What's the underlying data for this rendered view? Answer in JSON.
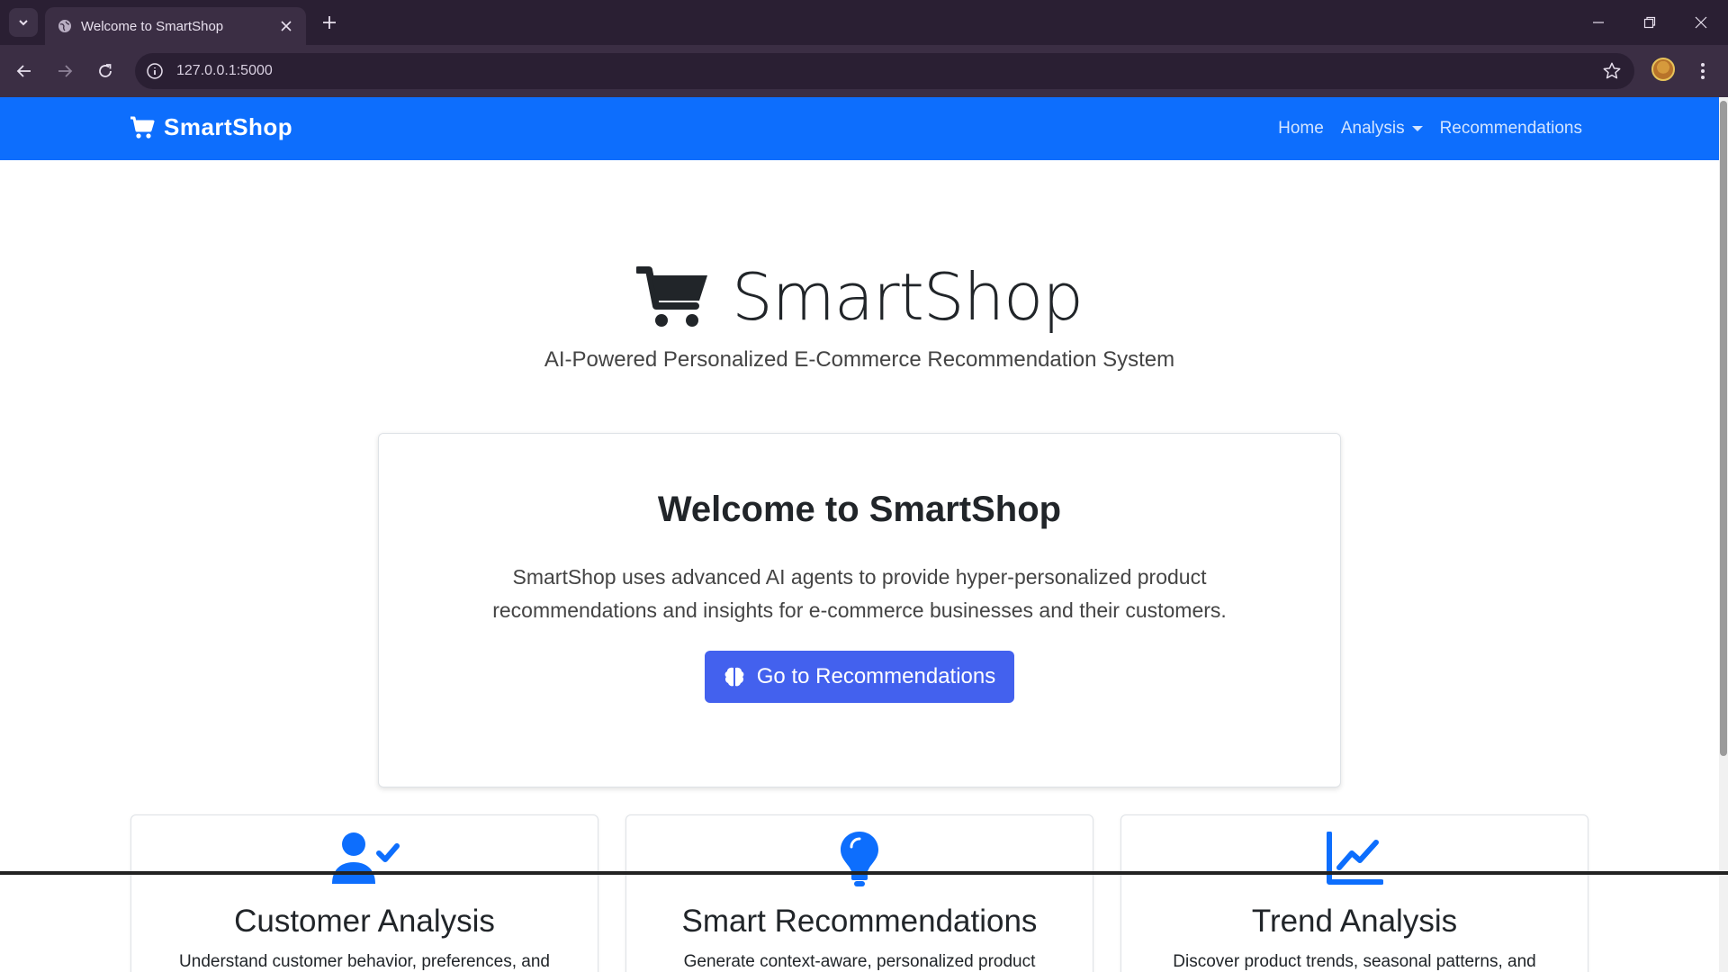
{
  "browser": {
    "tab_title": "Welcome to SmartShop",
    "url": "127.0.0.1:5000"
  },
  "navbar": {
    "brand": "SmartShop",
    "links": {
      "home": "Home",
      "analysis": "Analysis",
      "recommendations": "Recommendations"
    }
  },
  "hero": {
    "title": "SmartShop",
    "subtitle": "AI-Powered Personalized E-Commerce Recommendation System"
  },
  "welcome": {
    "title": "Welcome to SmartShop",
    "text": "SmartShop uses advanced AI agents to provide hyper-personalized product recommendations and insights for e-commerce businesses and their customers.",
    "button_label": "Go to Recommendations"
  },
  "features": [
    {
      "title": "Customer Analysis",
      "text": "Understand customer behavior, preferences, and",
      "icon": "user-check-icon"
    },
    {
      "title": "Smart Recommendations",
      "text": "Generate context-aware, personalized product",
      "icon": "lightbulb-icon"
    },
    {
      "title": "Trend Analysis",
      "text": "Discover product trends, seasonal patterns, and",
      "icon": "chart-line-icon"
    }
  ],
  "colors": {
    "primary": "#0d6efd",
    "accent": "#4361ee",
    "chrome": "#2a1f33"
  }
}
